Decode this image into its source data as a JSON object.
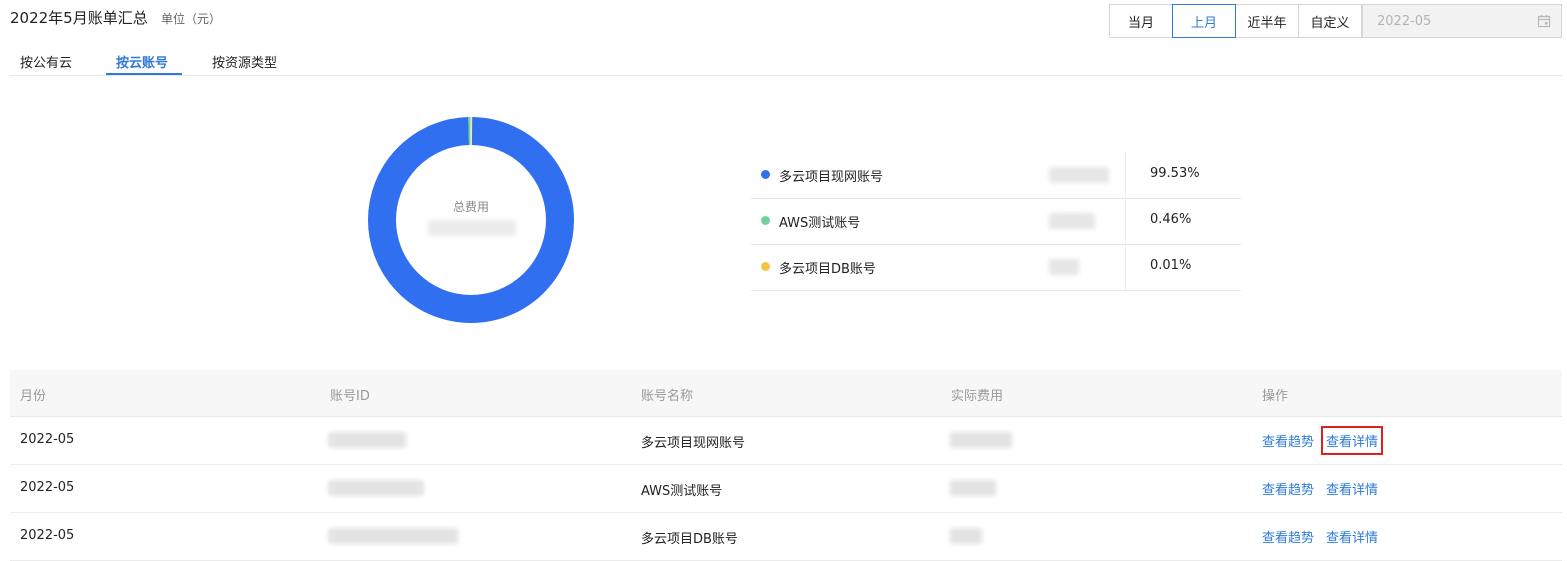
{
  "header": {
    "title": "2022年5月账单汇总",
    "unit": "单位（元）"
  },
  "period_buttons": [
    "当月",
    "上月",
    "近半年",
    "自定义"
  ],
  "period_active": "上月",
  "date_field": {
    "value": "2022-05",
    "icon": "calendar-icon"
  },
  "tabs": [
    "按公有云",
    "按云账号",
    "按资源类型"
  ],
  "tab_active": "按云账号",
  "donut": {
    "center_label": "总费用"
  },
  "chart_data": {
    "type": "pie",
    "categories": [
      "多云项目现网账号",
      "AWS测试账号",
      "多云项目DB账号"
    ],
    "values": [
      99.53,
      0.46,
      0.01
    ],
    "colors": [
      "#2f6ff0",
      "#6fd29d",
      "#f5c445"
    ],
    "legend_placement": "right"
  },
  "legend": [
    {
      "name": "多云项目现网账号",
      "percent": "99.53%",
      "color": "#2f6ff0"
    },
    {
      "name": "AWS测试账号",
      "percent": "0.46%",
      "color": "#6fd29d"
    },
    {
      "name": "多云项目DB账号",
      "percent": "0.01%",
      "color": "#f5c445"
    }
  ],
  "table": {
    "columns": [
      "月份",
      "账号ID",
      "账号名称",
      "实际费用",
      "操作"
    ],
    "rows": [
      {
        "month": "2022-05",
        "name": "多云项目现网账号"
      },
      {
        "month": "2022-05",
        "name": "AWS测试账号"
      },
      {
        "month": "2022-05",
        "name": "多云项目DB账号"
      }
    ],
    "actions": {
      "trend": "查看趋势",
      "detail": "查看详情"
    }
  }
}
